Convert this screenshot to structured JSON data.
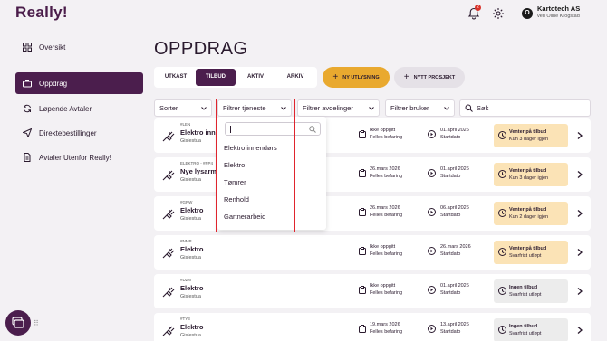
{
  "brand": {
    "logo": "Really!"
  },
  "header": {
    "notifications_badge": "2",
    "avatar_letter": "O",
    "company": "Kartotech AS",
    "user_sub": "ved Oline Krogstad"
  },
  "sidebar": {
    "items": [
      {
        "label": "Oversikt",
        "icon": "grid-icon",
        "active": false
      },
      {
        "label": "Oppdrag",
        "icon": "briefcase-icon",
        "active": true
      },
      {
        "label": "Løpende Avtaler",
        "icon": "refresh-icon",
        "active": false
      },
      {
        "label": "Direktebestillinger",
        "icon": "send-icon",
        "active": false
      },
      {
        "label": "Avtaler Utenfor Really!",
        "icon": "document-icon",
        "active": false
      }
    ]
  },
  "main": {
    "title": "OPPDRAG",
    "tabs": [
      {
        "label": "UTKAST"
      },
      {
        "label": "TILBUD"
      },
      {
        "label": "AKTIV"
      },
      {
        "label": "ARKIV"
      }
    ],
    "new_button": "NY UTLYSNING",
    "project_button": "NYTT PROSJEKT"
  },
  "filters": {
    "sort": "Sorter",
    "service": "Filtrer tjeneste",
    "department": "Filtrer avdelinger",
    "user": "Filtrer bruker",
    "search_placeholder": "Søk"
  },
  "service_dropdown": {
    "options": [
      "Elektro innendørs",
      "Elektro",
      "Tømrer",
      "Renhold",
      "Gartnerarbeid"
    ]
  },
  "rows": [
    {
      "id": "#LEN",
      "title": "Elektro inne",
      "location": "Gislestua",
      "date": "Ikke oppgitt",
      "date_sub": "Felles befaring",
      "start": "01.april 2026",
      "start_sub": "Startdato",
      "status": "Venter på tilbud",
      "status_sub": "Kun 3 dager igjen",
      "kind": "wait"
    },
    {
      "id": "ELEKTRO - #PP4",
      "title": "Nye lysarma",
      "location": "Gislestua",
      "date": "26.mars 2026",
      "date_sub": "Felles befaring",
      "start": "01.april 2026",
      "start_sub": "Startdato",
      "status": "Venter på tilbud",
      "status_sub": "Kun 3 dager igjen",
      "kind": "wait"
    },
    {
      "id": "#GRW",
      "title": "Elektro",
      "location": "Gislestua",
      "date": "26.mars 2026",
      "date_sub": "Felles befaring",
      "start": "06.april 2026",
      "start_sub": "Startdato",
      "status": "Venter på tilbud",
      "status_sub": "Kun 2 dager igjen",
      "kind": "wait"
    },
    {
      "id": "#NMP",
      "title": "Elektro",
      "location": "Gislestua",
      "date": "Ikke oppgitt",
      "date_sub": "Felles befaring",
      "start": "26.mars 2026",
      "start_sub": "Startdato",
      "status": "Venter på tilbud",
      "status_sub": "Svarfrist utløpt",
      "kind": "wait"
    },
    {
      "id": "#DZN",
      "title": "Elektro",
      "location": "Gislestua",
      "date": "Ikke oppgitt",
      "date_sub": "Felles befaring",
      "start": "01.april 2026",
      "start_sub": "Startdato",
      "status": "Ingen tilbud",
      "status_sub": "Svarfrist utløpt",
      "kind": "none"
    },
    {
      "id": "#TY3",
      "title": "Elektro",
      "location": "Gislestua",
      "date": "19.mars 2026",
      "date_sub": "Felles befaring",
      "start": "13.april 2026",
      "start_sub": "Startdato",
      "status": "Ingen tilbud",
      "status_sub": "Svarfrist utløpt",
      "kind": "none"
    }
  ],
  "colors": {
    "brand": "#4b1e4d",
    "accent": "#e9a92f",
    "wait_bg": "#fbe3b6",
    "none_bg": "#ececec",
    "highlight": "#e0242d"
  }
}
